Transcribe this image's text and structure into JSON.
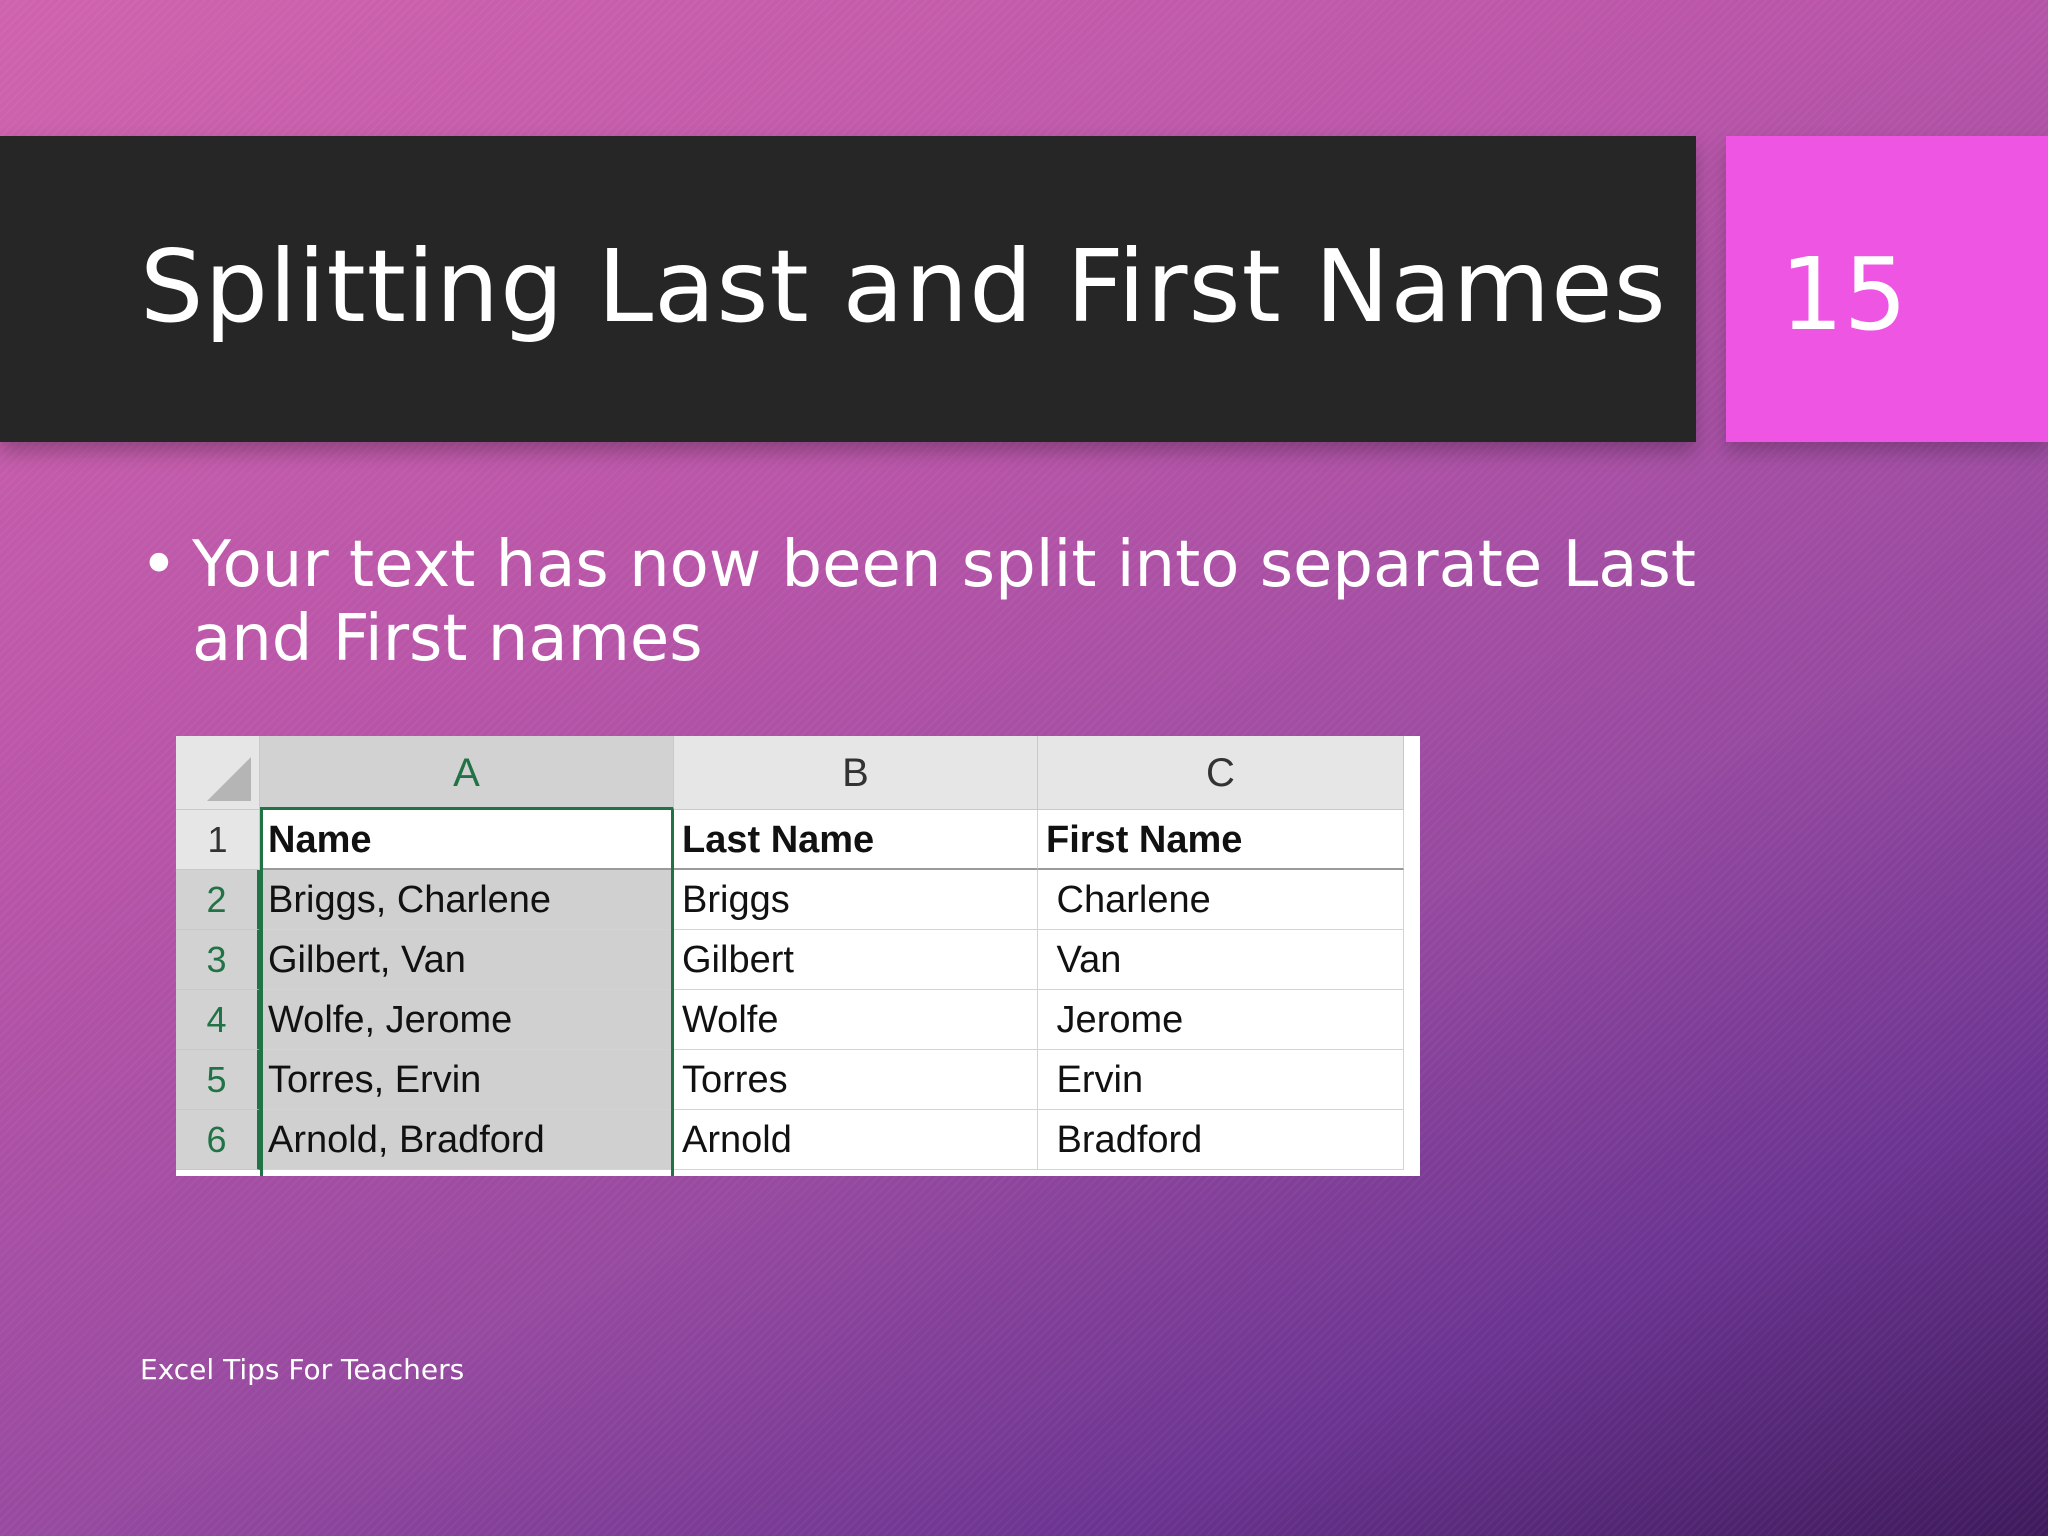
{
  "slide": {
    "title": "Splitting Last and First Names",
    "number": "15",
    "bullet": "Your text has now been split into separate Last and First names",
    "bullet_marker": "•",
    "footer": "Excel Tips For Teachers"
  },
  "sheet": {
    "columns": [
      "A",
      "B",
      "C"
    ],
    "row_numbers": [
      "1",
      "2",
      "3",
      "4",
      "5",
      "6"
    ],
    "rows": [
      [
        "Name",
        "Last Name",
        "First Name"
      ],
      [
        "Briggs, Charlene",
        "Briggs",
        " Charlene"
      ],
      [
        "Gilbert, Van",
        "Gilbert",
        " Van"
      ],
      [
        "Wolfe, Jerome",
        "Wolfe",
        " Jerome"
      ],
      [
        "Torres, Ervin",
        "Torres",
        " Ervin"
      ],
      [
        "Arnold, Bradford",
        "Arnold",
        " Bradford"
      ]
    ],
    "selected_column": "A",
    "accent_color": "#217346"
  },
  "colors": {
    "title_bar": "#262626",
    "number_box": "#ee55e2",
    "background_start": "#cf63ad",
    "background_end": "#3e1a5b"
  }
}
